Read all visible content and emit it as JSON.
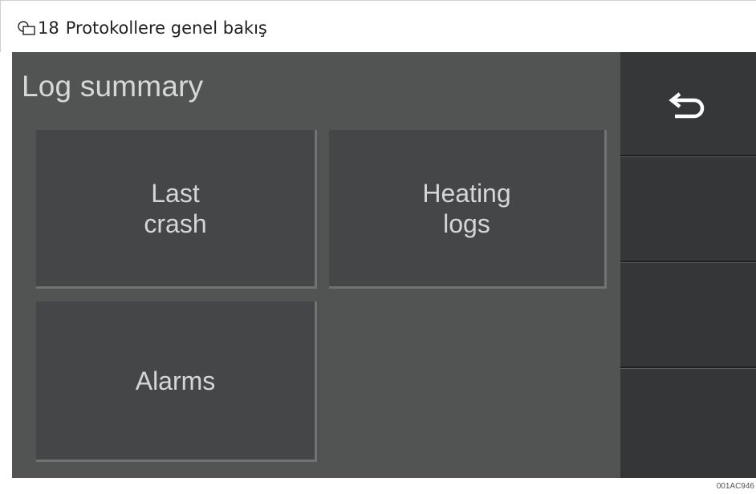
{
  "caption": {
    "icon": "figure-icon",
    "number": "18",
    "title": "Protokollere genel bakış"
  },
  "screen": {
    "title": "Log summary",
    "tiles": [
      {
        "label": "Last\ncrash"
      },
      {
        "label": "Heating\nlogs"
      },
      {
        "label": "Alarms"
      }
    ],
    "sidebar": {
      "back_icon": "return-arrow-icon"
    }
  },
  "figure_code": "001AC946",
  "colors": {
    "screen_bg": "#525353",
    "tile_bg": "#454647",
    "sidebar_bg": "#353637",
    "text": "#d6d6d6"
  }
}
